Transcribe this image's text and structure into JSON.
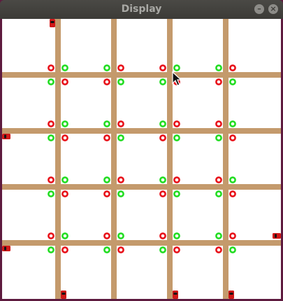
{
  "window": {
    "title": "Display",
    "minimize_label": "–",
    "close_label": "×"
  },
  "colors": {
    "titlebar": "#3c3b37",
    "road": "#c49a6c",
    "canvas": "#ffffff",
    "light_red": "#e8121a",
    "light_green": "#22dd22",
    "car_body": "#d01818",
    "car_window": "#111111"
  },
  "scene": {
    "intersections_per_row": 4,
    "intersections_per_column": 4,
    "intersections": [
      {
        "row": 1,
        "col": 1,
        "lights": [
          "red",
          "green",
          "green",
          "red"
        ]
      },
      {
        "row": 1,
        "col": 2,
        "lights": [
          "green",
          "red",
          "red",
          "green"
        ]
      },
      {
        "row": 1,
        "col": 3,
        "lights": [
          "red",
          "green",
          "green",
          "red"
        ]
      },
      {
        "row": 1,
        "col": 4,
        "lights": [
          "green",
          "red",
          "red",
          "green"
        ]
      },
      {
        "row": 2,
        "col": 1,
        "lights": [
          "red",
          "green",
          "green",
          "red"
        ]
      },
      {
        "row": 2,
        "col": 2,
        "lights": [
          "green",
          "red",
          "red",
          "green"
        ]
      },
      {
        "row": 2,
        "col": 3,
        "lights": [
          "green",
          "red",
          "red",
          "green"
        ]
      },
      {
        "row": 2,
        "col": 4,
        "lights": [
          "red",
          "green",
          "green",
          "red"
        ]
      },
      {
        "row": 3,
        "col": 1,
        "lights": [
          "red",
          "green",
          "green",
          "red"
        ]
      },
      {
        "row": 3,
        "col": 2,
        "lights": [
          "green",
          "red",
          "red",
          "green"
        ]
      },
      {
        "row": 3,
        "col": 3,
        "lights": [
          "green",
          "red",
          "red",
          "green"
        ]
      },
      {
        "row": 3,
        "col": 4,
        "lights": [
          "red",
          "green",
          "green",
          "red"
        ]
      },
      {
        "row": 4,
        "col": 1,
        "lights": [
          "red",
          "green",
          "green",
          "red"
        ]
      },
      {
        "row": 4,
        "col": 2,
        "lights": [
          "red",
          "green",
          "green",
          "red"
        ]
      },
      {
        "row": 4,
        "col": 3,
        "lights": [
          "red",
          "green",
          "green",
          "red"
        ]
      },
      {
        "row": 4,
        "col": 4,
        "lights": [
          "green",
          "red",
          "red",
          "green"
        ]
      }
    ],
    "cars": [
      {
        "road": "column-1",
        "heading": "down",
        "position": "top"
      },
      {
        "road": "row-2",
        "heading": "left",
        "position": "left-edge"
      },
      {
        "road": "row-4",
        "heading": "right",
        "position": "left-edge"
      },
      {
        "road": "row-4",
        "heading": "left",
        "position": "right-edge"
      },
      {
        "road": "column-1",
        "heading": "up",
        "position": "bottom"
      },
      {
        "road": "column-3",
        "heading": "up",
        "position": "bottom"
      },
      {
        "road": "column-4",
        "heading": "up",
        "position": "bottom"
      }
    ]
  }
}
